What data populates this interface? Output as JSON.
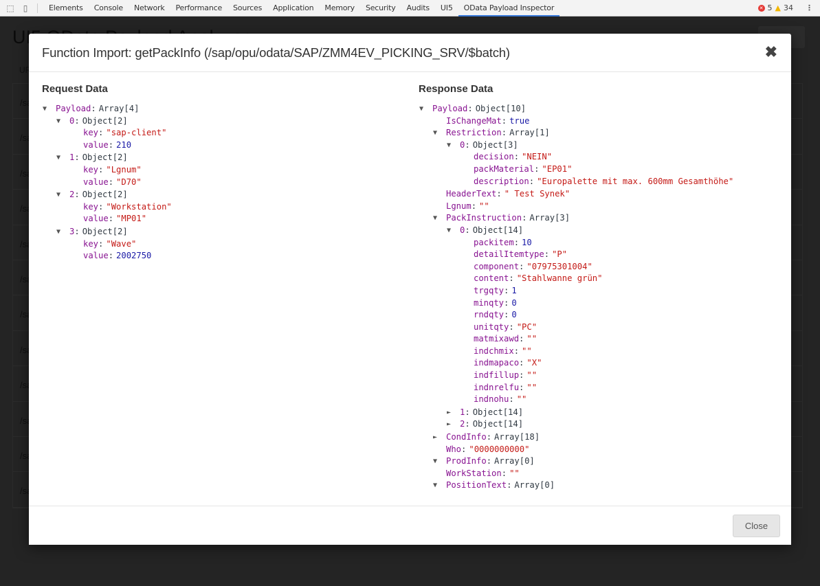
{
  "devtools": {
    "tabs": [
      "Elements",
      "Console",
      "Network",
      "Performance",
      "Sources",
      "Application",
      "Memory",
      "Security",
      "Audits",
      "UI5",
      "OData Payload Inspector"
    ],
    "active_tab": "OData Payload Inspector",
    "errors": "5",
    "warnings": "34"
  },
  "background": {
    "title": "UI5 OData Payload Analyzer",
    "column_header": "URL",
    "rows": [
      "/sap",
      "/sap",
      "/sap",
      "/sap",
      "/sap",
      "/sap",
      "/sap",
      "/sap",
      "/sap",
      "/sap",
      "/sap",
      "/sap"
    ]
  },
  "modal": {
    "title": "Function Import: getPackInfo (/sap/opu/odata/SAP/ZMM4EV_PICKING_SRV/$batch)",
    "close_label": "Close",
    "request": {
      "heading": "Request Data",
      "tree": [
        {
          "k": "Payload",
          "t": "Array[4]",
          "open": true,
          "c": [
            {
              "k": "0",
              "t": "Object[2]",
              "open": true,
              "c": [
                {
                  "k": "key",
                  "v": "\"sap-client\"",
                  "vt": "s"
                },
                {
                  "k": "value",
                  "v": "210",
                  "vt": "n"
                }
              ]
            },
            {
              "k": "1",
              "t": "Object[2]",
              "open": true,
              "c": [
                {
                  "k": "key",
                  "v": "\"Lgnum\"",
                  "vt": "s"
                },
                {
                  "k": "value",
                  "v": "\"D70\"",
                  "vt": "s"
                }
              ]
            },
            {
              "k": "2",
              "t": "Object[2]",
              "open": true,
              "c": [
                {
                  "k": "key",
                  "v": "\"Workstation\"",
                  "vt": "s"
                },
                {
                  "k": "value",
                  "v": "\"MP01\"",
                  "vt": "s"
                }
              ]
            },
            {
              "k": "3",
              "t": "Object[2]",
              "open": true,
              "c": [
                {
                  "k": "key",
                  "v": "\"Wave\"",
                  "vt": "s"
                },
                {
                  "k": "value",
                  "v": "2002750",
                  "vt": "n"
                }
              ]
            }
          ]
        }
      ]
    },
    "response": {
      "heading": "Response Data",
      "tree": [
        {
          "k": "Payload",
          "t": "Object[10]",
          "open": true,
          "c": [
            {
              "k": "IsChangeMat",
              "v": "true",
              "vt": "n"
            },
            {
              "k": "Restriction",
              "t": "Array[1]",
              "open": true,
              "c": [
                {
                  "k": "0",
                  "t": "Object[3]",
                  "open": true,
                  "c": [
                    {
                      "k": "decision",
                      "v": "\"NEIN\"",
                      "vt": "s"
                    },
                    {
                      "k": "packMaterial",
                      "v": "\"EP01\"",
                      "vt": "s"
                    },
                    {
                      "k": "description",
                      "v": "\"Europalette mit max. 600mm Gesamthöhe\"",
                      "vt": "s"
                    }
                  ]
                }
              ]
            },
            {
              "k": "HeaderText",
              "v": "\" Test Synek\"",
              "vt": "s"
            },
            {
              "k": "Lgnum",
              "v": "\"\"",
              "vt": "s"
            },
            {
              "k": "PackInstruction",
              "t": "Array[3]",
              "open": true,
              "c": [
                {
                  "k": "0",
                  "t": "Object[14]",
                  "open": true,
                  "c": [
                    {
                      "k": "packitem",
                      "v": "10",
                      "vt": "n"
                    },
                    {
                      "k": "detailItemtype",
                      "v": "\"P\"",
                      "vt": "s"
                    },
                    {
                      "k": "component",
                      "v": "\"07975301004\"",
                      "vt": "s"
                    },
                    {
                      "k": "content",
                      "v": "\"Stahlwanne grün\"",
                      "vt": "s"
                    },
                    {
                      "k": "trgqty",
                      "v": "1",
                      "vt": "n"
                    },
                    {
                      "k": "minqty",
                      "v": "0",
                      "vt": "n"
                    },
                    {
                      "k": "rndqty",
                      "v": "0",
                      "vt": "n"
                    },
                    {
                      "k": "unitqty",
                      "v": "\"PC\"",
                      "vt": "s"
                    },
                    {
                      "k": "matmixawd",
                      "v": "\"\"",
                      "vt": "s"
                    },
                    {
                      "k": "indchmix",
                      "v": "\"\"",
                      "vt": "s"
                    },
                    {
                      "k": "indmapaco",
                      "v": "\"X\"",
                      "vt": "s"
                    },
                    {
                      "k": "indfillup",
                      "v": "\"\"",
                      "vt": "s"
                    },
                    {
                      "k": "indnrelfu",
                      "v": "\"\"",
                      "vt": "s"
                    },
                    {
                      "k": "indnohu",
                      "v": "\"\"",
                      "vt": "s"
                    }
                  ]
                },
                {
                  "k": "1",
                  "t": "Object[14]",
                  "open": false
                },
                {
                  "k": "2",
                  "t": "Object[14]",
                  "open": false
                }
              ]
            },
            {
              "k": "CondInfo",
              "t": "Array[18]",
              "open": false
            },
            {
              "k": "Who",
              "v": "\"0000000000\"",
              "vt": "s"
            },
            {
              "k": "ProdInfo",
              "t": "Array[0]",
              "open": true,
              "c": []
            },
            {
              "k": "WorkStation",
              "v": "\"\"",
              "vt": "s"
            },
            {
              "k": "PositionText",
              "t": "Array[0]",
              "open": true,
              "c": []
            }
          ]
        }
      ]
    }
  }
}
